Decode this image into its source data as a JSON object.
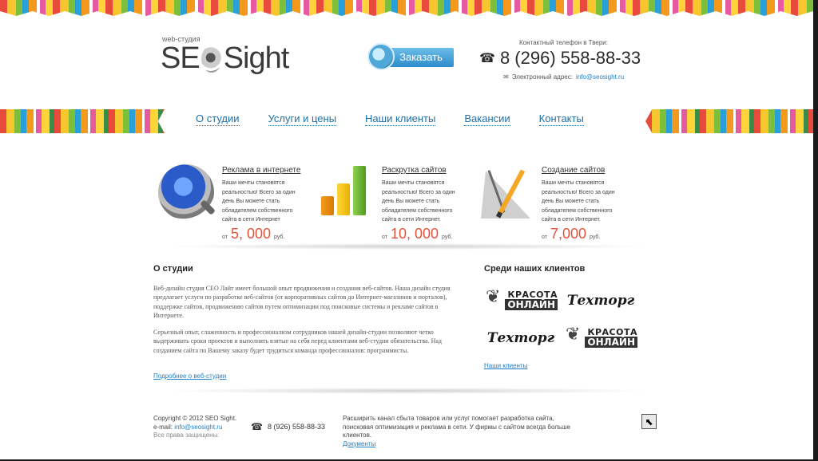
{
  "header": {
    "logo_small": "web-студия",
    "logo_left": "SE",
    "logo_right": "Sight",
    "order_button": "Заказать",
    "contact_title": "Контактный телефон в Твери:",
    "phone": "8 (296) 558-88-33",
    "email_label": "Электронный адрес:",
    "email": "info@seosight.ru"
  },
  "nav": {
    "items": [
      {
        "label": "О студии"
      },
      {
        "label": "Услуги и цены"
      },
      {
        "label": "Наши клиенты"
      },
      {
        "label": "Вакансии"
      },
      {
        "label": "Контакты"
      }
    ]
  },
  "services": [
    {
      "title": "Реклама в интернете",
      "desc": "Ваши мечты становятся реальностью! Всего за один день Вы можете стать обладателем собственного сайта в сети Интернет",
      "from": "от",
      "price": "5, 000",
      "currency": "руб.",
      "icon": "magnifier-globe-icon"
    },
    {
      "title": "Раскрутка сайтов",
      "desc": "Ваши мечты становятся реальностью! Всего за один день Вы можете стать обладателем собственного сайта в сети Интернет.",
      "from": "от",
      "price": "10, 000",
      "currency": "руб.",
      "icon": "bar-chart-icon"
    },
    {
      "title": "Создание сайтов",
      "desc": "Ваши мечты становятся реальностью! Всего за один день Вы можете стать обладателем собственного сайта в сети Интернет.",
      "from": "от",
      "price": "7,000",
      "currency": "руб.",
      "icon": "drafting-tools-icon"
    }
  ],
  "about": {
    "heading": "О студии",
    "para1": "Веб-дизайн студия СЕО Лайт имеет большой опыт продвижения и создания веб-сайтов. Наша дизайн студия предлагает услуги по разработке веб-сайтов (от корпоративных сайтов до Интернет-магазинов и порталов), поддержке сайтов, продвижению сайтов путем оптимизации под поисковые системы и рекламе сайтов в Интернете.",
    "para2": "Серьезный опыт, слаженность и профессионализм сотрудников нашей дизайн-студии позволяют четко выдерживать сроки проектов и выполнять взятые на себя перед клиентами веб-студии обязательства. Над созданием сайта по Вашему заказу будет трудиться команда профессионалов: программисты.",
    "more_link": "Подробнее о веб-студии"
  },
  "clients": {
    "heading": "Среди наших клиентов",
    "krasota_1": "КРАСОТА",
    "krasota_2": "ОНЛАЙН",
    "tehtorg": "Техторг",
    "link": "Наши клиенты"
  },
  "footer": {
    "copyright": "Copyright © 2012 SEO Sight.",
    "email_label": "e-mail:",
    "email": "info@seosight.ru",
    "rights": "Все права защищены.",
    "phone": "8 (926) 558-88-33",
    "text": "Расширить канал сбыта товаров или услуг помогает разработка сайта, поисковая оптимизация и реклама в сети. У фирмы с сайтом всегда больше клиентов.",
    "docs_link": "Документы",
    "up_icon": "arrow-up-left-icon"
  },
  "colors": {
    "accent_blue": "#1e7fc8",
    "price_red": "#e2533a"
  }
}
